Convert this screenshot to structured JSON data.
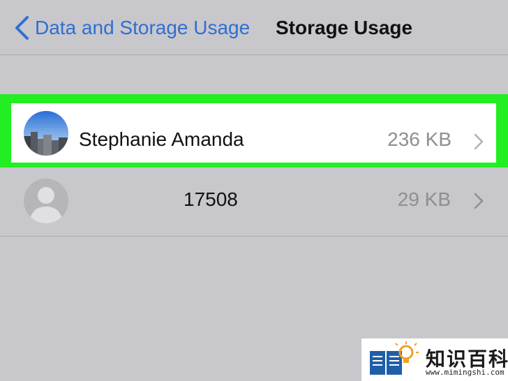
{
  "nav": {
    "back_label": "Data and Storage Usage",
    "title": "Storage Usage"
  },
  "items": [
    {
      "name": "Stephanie Amanda",
      "size": "236 KB",
      "highlighted": true
    },
    {
      "name": "17508",
      "size": "29 KB",
      "highlighted": false
    }
  ],
  "watermark": {
    "text": "知识百科",
    "url": "www.mimingshi.com"
  },
  "colors": {
    "accent": "#2f6fd0",
    "highlight": "#22ee22",
    "background": "#c8c7cc"
  }
}
